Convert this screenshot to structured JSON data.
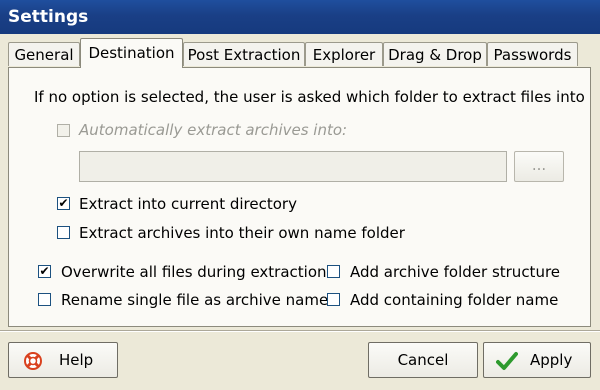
{
  "window": {
    "title": "Settings"
  },
  "tabs": [
    {
      "label": "General",
      "active": false
    },
    {
      "label": "Destination",
      "active": true
    },
    {
      "label": "Post Extraction",
      "active": false
    },
    {
      "label": "Explorer",
      "active": false
    },
    {
      "label": "Drag & Drop",
      "active": false
    },
    {
      "label": "Passwords",
      "active": false
    }
  ],
  "destination": {
    "info_text": "If no option is selected, the user is asked which folder to extract files into",
    "auto_extract": {
      "label": "Automatically extract archives into:",
      "checked": false,
      "enabled": false
    },
    "path_field": {
      "value": ""
    },
    "browse_label": "...",
    "current_dir": {
      "label": "Extract into current directory",
      "checked": true
    },
    "own_folder": {
      "label": "Extract archives into their own name folder",
      "checked": false
    },
    "overwrite": {
      "label": "Overwrite all files during extraction",
      "checked": true
    },
    "rename_single": {
      "label": "Rename single file as archive name",
      "checked": false
    },
    "archive_structure": {
      "label": "Add archive folder structure",
      "checked": false
    },
    "containing_folder": {
      "label": "Add containing folder name",
      "checked": false
    }
  },
  "footer": {
    "help_label": "Help",
    "cancel_label": "Cancel",
    "apply_label": "Apply",
    "colors": {
      "help_icon": "#d9411e",
      "apply_check": "#2e9a2e"
    }
  },
  "icons": {
    "help": "lifebuoy-icon",
    "apply": "checkmark-icon",
    "check": "✔"
  }
}
